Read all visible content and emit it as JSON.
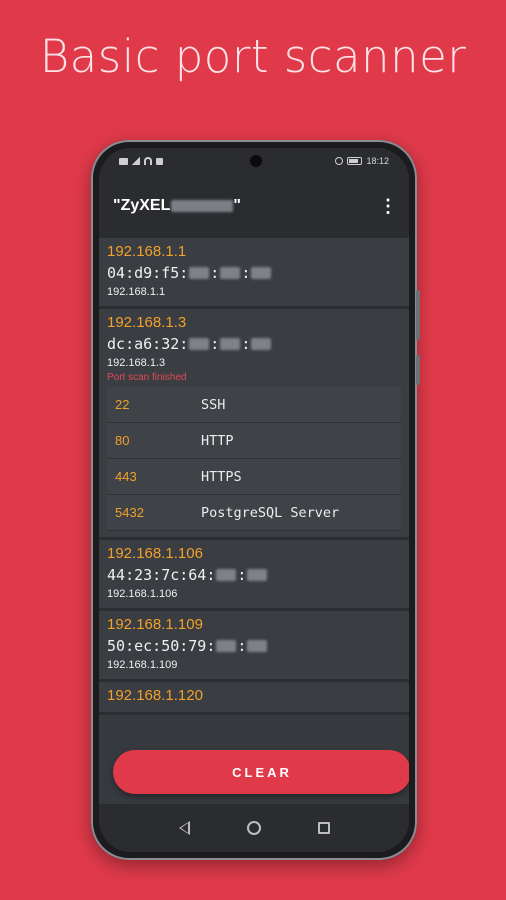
{
  "headline": "Basic port scanner",
  "status_bar": {
    "time": "18:12"
  },
  "app_bar": {
    "title_prefix": "\"ZyXEL",
    "title_suffix": "\"",
    "menu_icon": "more-vert-icon"
  },
  "hosts": [
    {
      "ip": "192.168.1.1",
      "mac_visible": [
        "04",
        "d9",
        "f5"
      ],
      "hostname": "192.168.1.1"
    },
    {
      "ip": "192.168.1.3",
      "mac_visible": [
        "dc",
        "a6",
        "32"
      ],
      "hostname": "192.168.1.3",
      "scan_status": "Port scan finished",
      "ports": [
        {
          "port": "22",
          "service": "SSH"
        },
        {
          "port": "80",
          "service": "HTTP"
        },
        {
          "port": "443",
          "service": "HTTPS"
        },
        {
          "port": "5432",
          "service": "PostgreSQL Server"
        }
      ]
    },
    {
      "ip": "192.168.1.106",
      "mac_visible": [
        "44",
        "23",
        "7c",
        "64"
      ],
      "hostname": "192.168.1.106"
    },
    {
      "ip": "192.168.1.109",
      "mac_visible": [
        "50",
        "ec",
        "50",
        "79"
      ],
      "hostname": "192.168.1.109"
    },
    {
      "ip": "192.168.1.120"
    }
  ],
  "clear_button": {
    "label": "CLEAR"
  },
  "colors": {
    "background": "#e03a4a",
    "accent": "#f2a12a",
    "surface": "#3a3d42"
  }
}
